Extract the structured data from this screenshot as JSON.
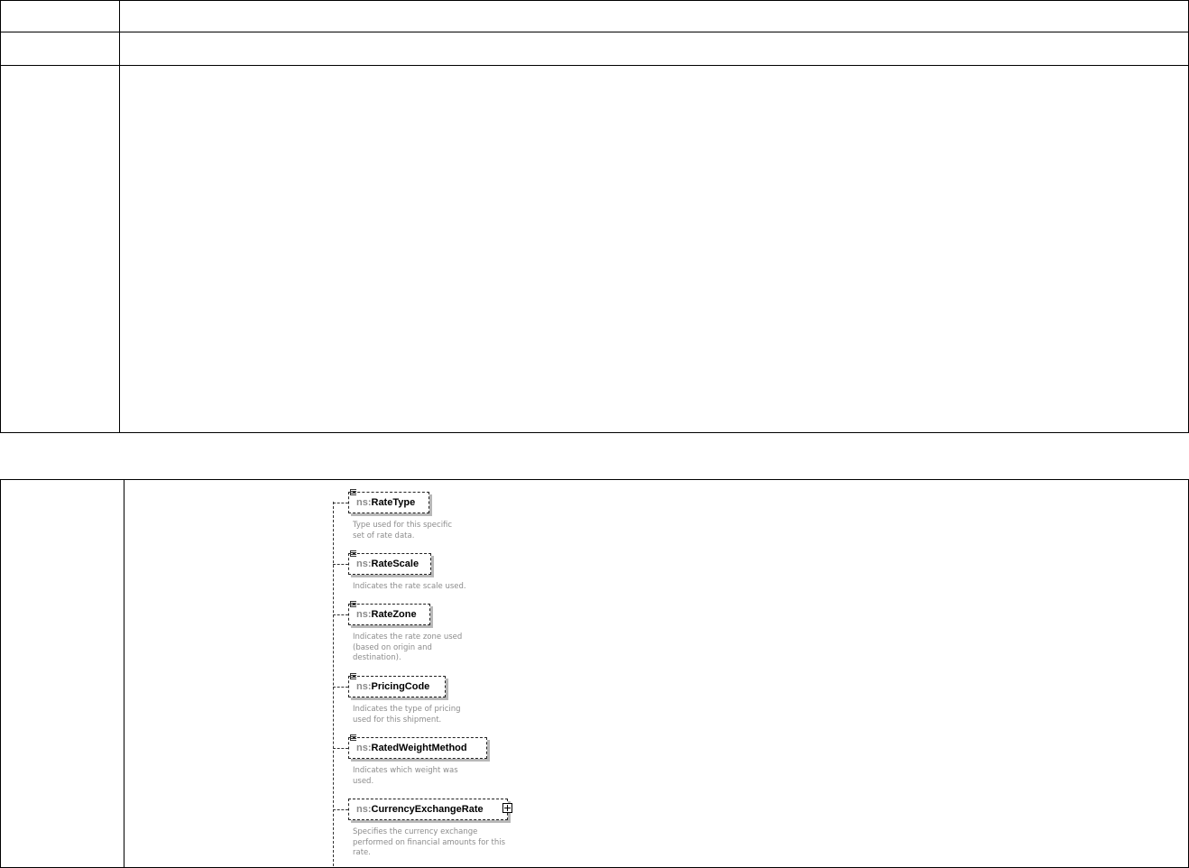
{
  "diagram": {
    "elements": [
      {
        "prefix": "ns:",
        "name": "RateType",
        "doc": "Type used for this specific\nset of rate data.",
        "icon": "annotation-glyph-icon",
        "expandable": false
      },
      {
        "prefix": "ns:",
        "name": "RateScale",
        "doc": "Indicates the rate scale used.",
        "icon": "annotation-glyph-icon",
        "expandable": false
      },
      {
        "prefix": "ns:",
        "name": "RateZone",
        "doc": "Indicates the rate zone used\n(based on origin and\ndestination).",
        "icon": "annotation-glyph-icon",
        "expandable": false
      },
      {
        "prefix": "ns:",
        "name": "PricingCode",
        "doc": "Indicates the type of pricing\nused for this shipment.",
        "icon": "annotation-glyph-icon",
        "expandable": false
      },
      {
        "prefix": "ns:",
        "name": "RatedWeightMethod",
        "doc": "Indicates which weight was\nused.",
        "icon": "annotation-glyph-icon",
        "expandable": false
      },
      {
        "prefix": "ns:",
        "name": "CurrencyExchangeRate",
        "doc": "Specifies the currency exchange\nperformed on financial amounts for this\nrate.",
        "icon": "expand-plus-icon",
        "expandable": true
      }
    ]
  }
}
